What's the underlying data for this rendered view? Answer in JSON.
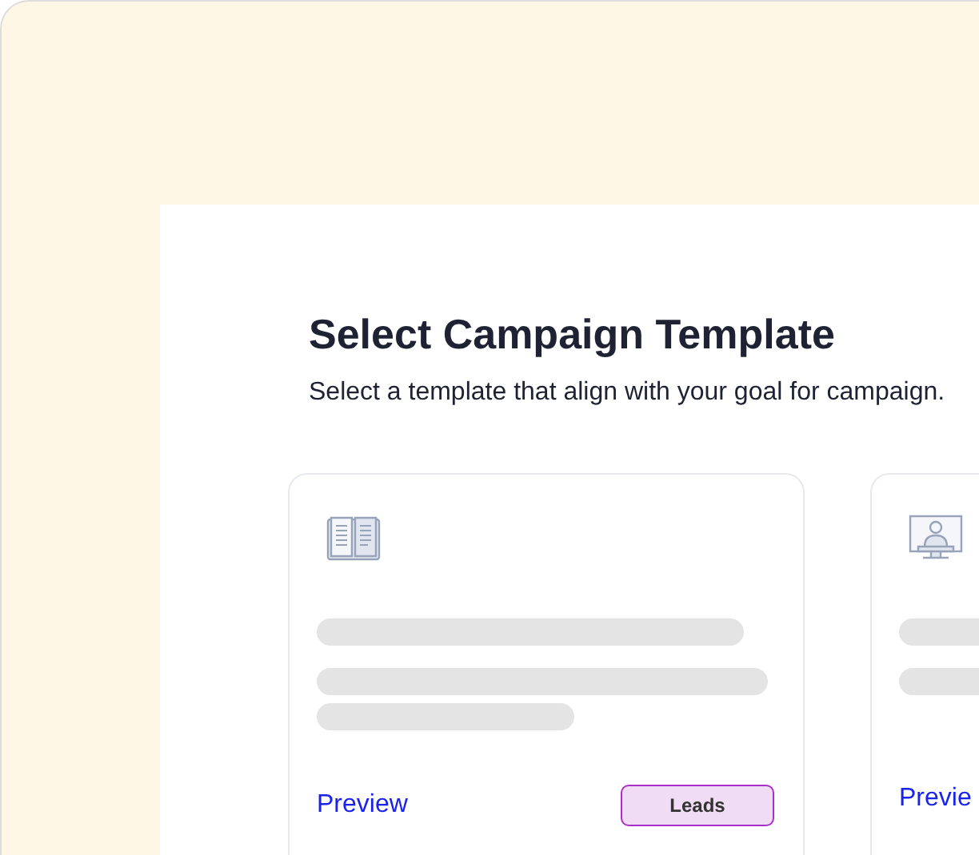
{
  "page": {
    "title": "Select Campaign Template",
    "subtitle": "Select a template that align with your goal for campaign."
  },
  "cards": [
    {
      "preview_link": "Preview",
      "tag": "Leads"
    },
    {
      "preview_link": "Previe"
    }
  ]
}
